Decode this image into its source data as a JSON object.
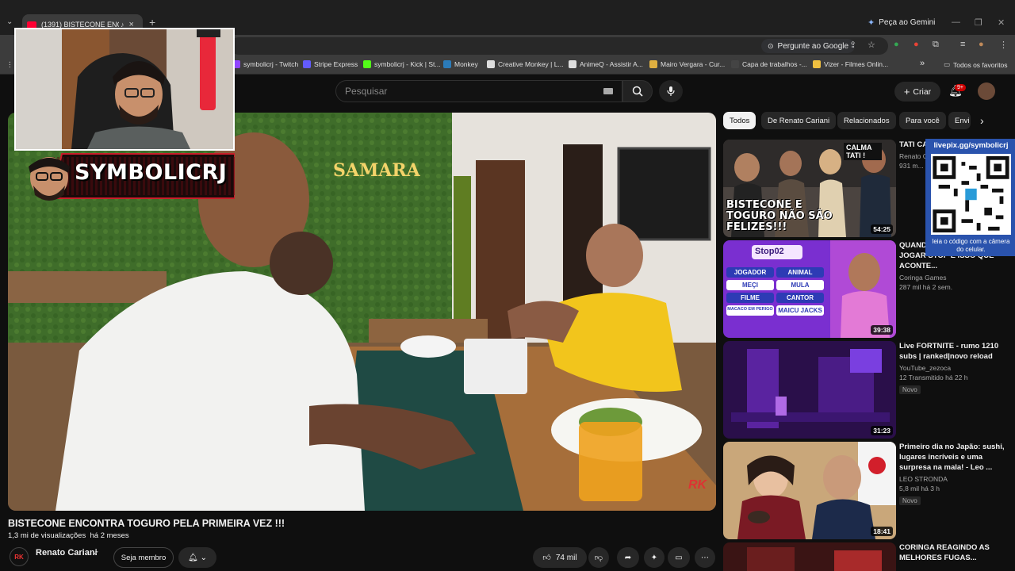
{
  "browser": {
    "tab_title": "(1391) BISTECONE ENCONT",
    "gemini_label": "Peça ao Gemini",
    "ask_google_label": "Pergunte ao Google",
    "bookmarks": [
      {
        "label": "symbolicrj - Twitch",
        "color": "#9146ff"
      },
      {
        "label": "Stripe Express",
        "color": "#635bff"
      },
      {
        "label": "symbolicrj - Kick | St...",
        "color": "#53fc18"
      },
      {
        "label": "Monkey",
        "color": "#2b7bb9"
      },
      {
        "label": "Creative Monkey | L...",
        "color": "#dddddd"
      },
      {
        "label": "AnimeQ - Assistir A...",
        "color": "#dddddd"
      },
      {
        "label": "Mairo Vergara - Cur...",
        "color": "#e0b040"
      },
      {
        "label": "Capa de trabalhos -...",
        "color": "#444444"
      },
      {
        "label": "Vizer - Filmes Onlin...",
        "color": "#f0c040"
      }
    ],
    "bookmarks_more": "»",
    "all_favorites_label": "Todos os favoritos"
  },
  "youtube": {
    "search_placeholder": "Pesquisar",
    "create_label": "Criar",
    "notifications_count": "9+",
    "video": {
      "title": "BISTECONE ENCONTRA TOGURO PELA PRIMEIRA VEZ !!!",
      "views": "1,3 mi de visualizações",
      "age": "há 2 meses",
      "channel": "Renato Cariani",
      "join_label": "Seja membro",
      "likes": "74 mil"
    },
    "chips": [
      "Todos",
      "De Renato Cariani",
      "Relacionados",
      "Para você",
      "Envi"
    ],
    "recommendations": [
      {
        "title": "TATI CA... BISTEC... CLIMA...",
        "channel": "Renato C...",
        "stats": "931 m...",
        "duration": "54:25",
        "thumb_text": "BISTECONE E TOGURO NÃO SÃO FELIZES!!!",
        "thumb_small": "CALMA TATI !"
      },
      {
        "title": "QUANDO... OS AMIGOS PRA JOGAR STOP É ISSO QUE ACONTE...",
        "channel": "Coringa Games",
        "stats": "287 mil   há 2 sem.",
        "duration": "39:38",
        "thumb_text": "Stop02",
        "stop_cells": [
          "JOGADOR",
          "ANIMAL",
          "MEÇI",
          "MULA",
          "FILME",
          "CANTOR",
          "MACACO EM PERIGO",
          "MAICU JACKS"
        ]
      },
      {
        "title": "Live FORTNITE -  rumo 1210 subs | ranked|novo reload",
        "channel": "YouTube_zezoca",
        "stats": "12  Transmitido há 22 h",
        "duration": "31:23",
        "badge": "Novo"
      },
      {
        "title": "Primeiro dia no Japão: sushi, lugares incríveis e uma surpresa na mala! - Leo ...",
        "channel": "LEO STRONDA",
        "stats": "5,8 mil   há 3 h",
        "duration": "18:41",
        "badge": "Novo"
      },
      {
        "title": "CORINGA REAGINDO AS MELHORES FUGAS...",
        "channel": "",
        "stats": "",
        "duration": ""
      }
    ]
  },
  "overlay": {
    "streamer_name": "SYMBOLICRJ",
    "qr_url": "livepix.gg/symbolicrj",
    "qr_caption": "leia o código com a câmera do celular.",
    "video_sign": "SAMARA",
    "watermark": "RK"
  },
  "colors": {
    "yt_bg": "#0f0f0f",
    "brand_red": "#ff0033",
    "qr_blue": "#2a53ad",
    "jersey_yellow": "#f2c51c"
  }
}
